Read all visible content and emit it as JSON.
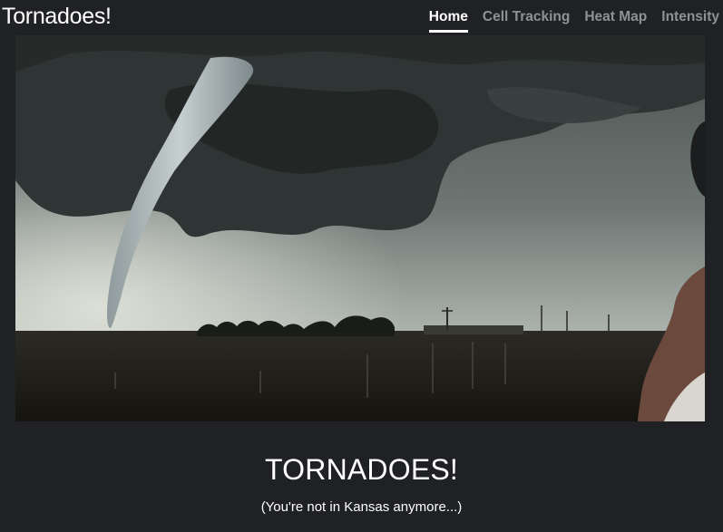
{
  "header": {
    "brand": "Tornadoes!",
    "nav": [
      {
        "label": "Home",
        "active": true
      },
      {
        "label": "Cell Tracking",
        "active": false
      },
      {
        "label": "Heat Map",
        "active": false
      },
      {
        "label": "Intensity",
        "active": false
      }
    ]
  },
  "main": {
    "hero_image": "tornado-photo",
    "title": "TORNADOES!",
    "subtitle": "(You're not in Kansas anymore...)"
  },
  "colors": {
    "background": "#1f2124",
    "text": "#ffffff",
    "nav_inactive": "#8e9196"
  }
}
